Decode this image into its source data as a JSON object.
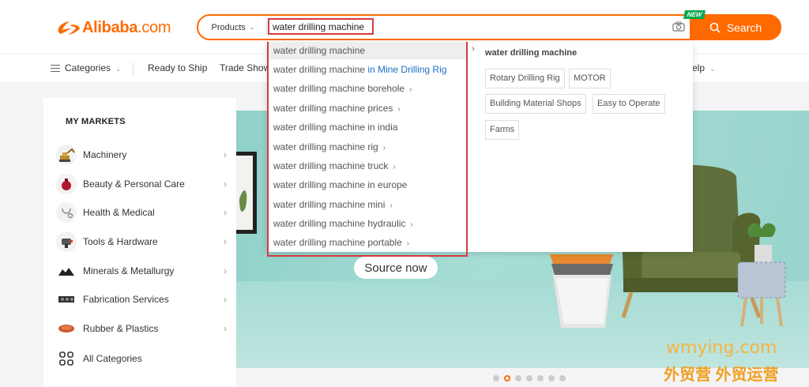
{
  "header": {
    "logo_text": "Alibaba",
    "logo_domain": ".com",
    "search": {
      "category": "Products",
      "query": "water drilling machine",
      "button_label": "Search",
      "new_badge": "NEW"
    }
  },
  "nav": {
    "items": [
      "Categories",
      "Ready to Ship",
      "Trade Show",
      "elp"
    ]
  },
  "suggestions": [
    {
      "text": "water drilling machine",
      "extra": "",
      "arrow": false
    },
    {
      "text": "water drilling machine",
      "extra": " in Mine Drilling Rig",
      "arrow": false
    },
    {
      "text": "water drilling machine borehole",
      "extra": "",
      "arrow": true
    },
    {
      "text": "water drilling machine prices",
      "extra": "",
      "arrow": true
    },
    {
      "text": "water drilling machine in india",
      "extra": "",
      "arrow": false
    },
    {
      "text": "water drilling machine rig",
      "extra": "",
      "arrow": true
    },
    {
      "text": "water drilling machine truck",
      "extra": "",
      "arrow": true
    },
    {
      "text": "water drilling machine in europe",
      "extra": "",
      "arrow": false
    },
    {
      "text": "water drilling machine mini",
      "extra": "",
      "arrow": true
    },
    {
      "text": "water drilling machine hydraulic",
      "extra": "",
      "arrow": true
    },
    {
      "text": "water drilling machine portable",
      "extra": "",
      "arrow": true
    }
  ],
  "related": {
    "title": "water drilling machine",
    "tags": [
      "Rotary Drilling Rig",
      "MOTOR",
      "Building Material Shops",
      "Easy to Operate",
      "Farms"
    ]
  },
  "markets": {
    "title": "MY MARKETS",
    "items": [
      {
        "label": "Machinery",
        "icon": "excavator-icon"
      },
      {
        "label": "Beauty & Personal Care",
        "icon": "perfume-icon"
      },
      {
        "label": "Health & Medical",
        "icon": "stethoscope-icon"
      },
      {
        "label": "Tools & Hardware",
        "icon": "tools-icon"
      },
      {
        "label": "Minerals & Metallurgy",
        "icon": "minerals-icon"
      },
      {
        "label": "Fabrication Services",
        "icon": "gear-icon"
      },
      {
        "label": "Rubber & Plastics",
        "icon": "rubber-icon"
      },
      {
        "label": "All Categories",
        "icon": "grid-icon"
      }
    ]
  },
  "banner": {
    "cta": "Source now",
    "slides": 7,
    "active_slide": 2
  },
  "watermark": {
    "en": "wmying.com",
    "cn": "外贸营 外贸运营"
  },
  "colors": {
    "brand": "#ff6a00",
    "highlight_box": "#d23c3c",
    "link_blue": "#1a6fc4",
    "badge_green": "#0aa84f"
  }
}
